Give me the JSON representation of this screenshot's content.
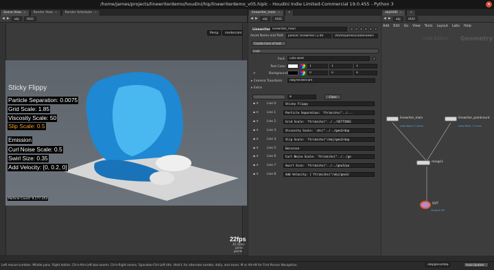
{
  "window": {
    "title": "/home/james/projects/linewriterdemo/houdini/hip/linewriterdemo_v05.hiplc - Houdini Indie Limited-Commercial 19.0.455 - Python 3"
  },
  "left_pane": {
    "tabs": [
      "Scene View",
      "Render View",
      "Render Scheduler"
    ],
    "path": "obj",
    "context": "HUD",
    "persp_label": "Persp",
    "camera_label": "rendercam"
  },
  "hud": {
    "title": "Sticky Flippy",
    "lines": [
      "Particle Separation: 0.0075",
      "Grid Scale: 1.85",
      "Viscosity Scale: 50",
      "Slip Scale: 0.5"
    ],
    "emission_title": "Emission",
    "emission_lines": [
      "Curl Noise Scale: 0.5",
      "Swirl Size: 0.35",
      "Add Velocity: [0, 0.2, 0]"
    ],
    "particle_count": "Particle Count: 9,177,353",
    "fps": "22fps",
    "ms": "45.33ms",
    "poly_label": "prims",
    "points_label": "points"
  },
  "param_pane": {
    "tabs": [
      "linewriter_main",
      "+"
    ],
    "path": "obj",
    "context": "HUD",
    "node_type": "Linewriter",
    "node_name": "linewriter_main",
    "asset_tab": "Asset Name and Path",
    "asset_name": "pelicer::linewriter::2.00",
    "asset_path": "/home/james/code/linewri",
    "section_lines": "Create lines of text",
    "section_look": "Look",
    "font_label": "Font",
    "font_value": "Lato Bold",
    "text_color_label": "Text Color",
    "text_color": [
      "1",
      "1",
      "1"
    ],
    "background_label": "Background",
    "background_color": [
      "0",
      "0",
      "0"
    ],
    "camera_label": "Camera Transform",
    "camera_value": "/obj/rendercam",
    "extra_label": "Extra",
    "num_lines": "8",
    "clear_label": "Clear",
    "lines": [
      {
        "label": "Line 0",
        "value": "Sticky Flippy"
      },
      {
        "label": "Line 1",
        "value": "Particle Separation: `ftrim(chs(\"../..."
      },
      {
        "label": "Line 2",
        "value": "Grid Scale: `ftrim(chs(\"../../SETTINGS"
      },
      {
        "label": "Line 3",
        "value": "Viscosity Scale: `chs(\"../../geo3/dop"
      },
      {
        "label": "Line 4",
        "value": "Slip Scale: `ftrim(chs(\"/obj/geo3/dop"
      },
      {
        "label": "Line 5",
        "value": "Emission"
      },
      {
        "label": "Line 6",
        "value": "Curl Noise Scale: `ftrim(chs(\"../../ge"
      },
      {
        "label": "Line 7",
        "value": "Swirl Size: `ftrim(chs(\"../../geo3/po"
      },
      {
        "label": "Line 8",
        "value": "Add Velocity: [`ftrim(chs(\"/obj/geo3/"
      }
    ]
  },
  "network": {
    "tabs": [
      "obj/HUD",
      "+"
    ],
    "path": "obj",
    "context": "HUD",
    "menu": [
      "Add",
      "Edit",
      "Go",
      "View",
      "Tools",
      "Layout",
      "Labs",
      "Help"
    ],
    "watermark_edition": "Indie Edition",
    "watermark_context": "Geometry",
    "nodes": [
      {
        "name": "linewriter_main",
        "sub": "Lato Bold, 9 Lines"
      },
      {
        "name": "linewriter_pointcount",
        "sub": "Lato Bold, 1 Lines"
      },
      {
        "name": "merge1",
        "sub": ""
      },
      {
        "name": "OUT",
        "sub": "Output #0"
      }
    ]
  },
  "status": {
    "text": "Left mouse tumbles. Middle pans. Right dollies. Ctrl+Alt+Left box-zooms. Ctrl+Right zooms. Spacebar-Ctrl-Left tilts. Hold L for alternate tumble, dolly, and zoom.    M or Alt+M for First Person Navigation.",
    "path_field": "/obj/geo3/dop...",
    "update_mode": "Auto Update"
  }
}
